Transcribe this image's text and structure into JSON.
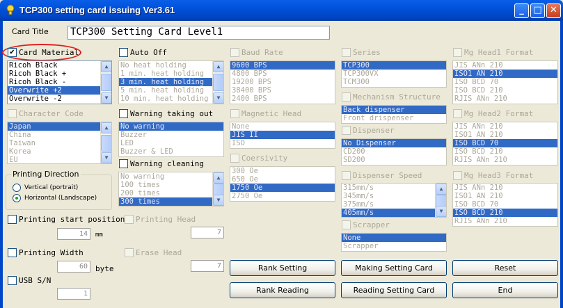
{
  "window": {
    "title": "TCP300 setting card issuing Ver3.61",
    "minimize_glyph": "_",
    "maximize_glyph": "□",
    "close_glyph": "✕",
    "accent_color": "#316ac5",
    "titlebar_color": "#0050d8",
    "annotation_color": "#e02020"
  },
  "card_title": {
    "label": "Card Title",
    "value": "TCP300 Setting Card  Level1"
  },
  "card_material": {
    "label": "Card Material",
    "checked": "✔",
    "items": [
      "Ricoh Black",
      "Ricoh Black +",
      "Ricoh Black -",
      "Overwrite +2",
      "Overwrite -2"
    ],
    "selected": 3
  },
  "character_code": {
    "label": "Character Code",
    "items": [
      "Japan",
      "China",
      "Taiwan",
      "Korea",
      "EU"
    ],
    "selected": 0
  },
  "printing_direction": {
    "label": "Printing Direction",
    "options": [
      "Vertical (portrait)",
      "Horizontal (Landscape)"
    ],
    "selected": 1
  },
  "printing_start_position": {
    "label": "Printing start position",
    "value": "14",
    "unit": "mm"
  },
  "printing_head": {
    "label": "Printing Head",
    "value": "7"
  },
  "printing_width": {
    "label": "Printing Width",
    "value": "60",
    "unit": "byte"
  },
  "erase_head": {
    "label": "Erase Head",
    "value": "7"
  },
  "usb_sn": {
    "label": "USB S/N",
    "value": "1"
  },
  "auto_off": {
    "label": "Auto Off",
    "items": [
      "No heat holding",
      "1 min. heat holding",
      "3 min. heat holding",
      "5 min. heat holding",
      "10 min. heat holding"
    ],
    "selected": 2
  },
  "warning_taking_out": {
    "label": "Warning taking out",
    "items": [
      "No warning",
      "Buzzer",
      "LED",
      "Buzzer & LED"
    ],
    "selected": 0
  },
  "warning_cleaning": {
    "label": "Warning cleaning",
    "items": [
      "No warning",
      "100 times",
      "200 times",
      "300 times"
    ],
    "selected": 3
  },
  "baud_rate": {
    "label": "Baud Rate",
    "items": [
      "9600 BPS",
      "4800 BPS",
      "19200 BPS",
      "38400 BPS",
      "2400 BPS"
    ],
    "selected": 0
  },
  "magnetic_head": {
    "label": "Magnetic Head",
    "items": [
      "None",
      "JIS II",
      "ISO"
    ],
    "selected": 1
  },
  "coersivity": {
    "label": "Coersivity",
    "items": [
      " 300 Oe",
      " 650 Oe",
      "1750 Oe",
      "2750 Oe"
    ],
    "selected": 2
  },
  "series": {
    "label": "Series",
    "items": [
      "TCP300",
      "TCP300VX",
      "TCM300"
    ],
    "selected": 0
  },
  "mechanism_structure": {
    "label": "Mechanism Structure",
    "items": [
      "Back dispenser",
      "Front drispenser"
    ],
    "selected": 0
  },
  "dispenser": {
    "label": "Dispenser",
    "items": [
      "No Dispenser",
      "CD200",
      "SD200"
    ],
    "selected": 0
  },
  "dispenser_speed": {
    "label": "Dispenser Speed",
    "items": [
      "315mm/s",
      "345mm/s",
      "375mm/s",
      "405mm/s"
    ],
    "selected": 3
  },
  "scrapper": {
    "label": "Scrapper",
    "items": [
      "None",
      "Scrapper"
    ],
    "selected": 0
  },
  "mg_head1": {
    "label": "Mg Head1 Format",
    "items": [
      "JIS ANn 210",
      "ISO1 AN 210",
      "ISO BCD 70",
      "ISO BCD 210",
      "RJIS ANn 210"
    ],
    "selected": 1
  },
  "mg_head2": {
    "label": "Mg Head2 Format",
    "items": [
      "JIS ANn 210",
      "ISO1 AN 210",
      "ISO BCD 70",
      "ISO BCD 210",
      "RJIS ANn 210"
    ],
    "selected": 2
  },
  "mg_head3": {
    "label": "Mg Head3 Format",
    "items": [
      "JIS ANn 210",
      "ISO1 AN 210",
      "ISO BCD 70",
      "ISO BCD 210",
      "RJIS ANn 210"
    ],
    "selected": 3
  },
  "buttons": {
    "rank_setting": "Rank Setting",
    "making_setting_card": "Making Setting Card",
    "reset": "Reset",
    "rank_reading": "Rank Reading",
    "reading_setting_card": "Reading Setting Card",
    "end": "End"
  },
  "icons": {
    "scroll_up": "▲",
    "scroll_down": "▼"
  }
}
